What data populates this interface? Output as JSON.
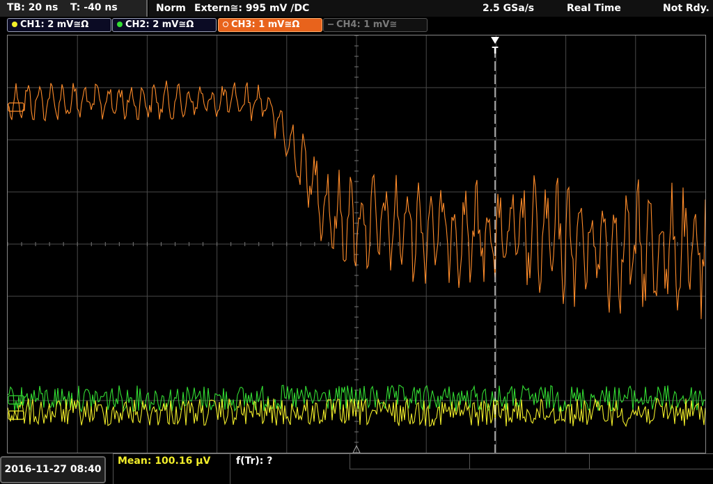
{
  "header": {
    "timebase": "TB: 20 ns",
    "trigger_time": "T: -40 ns",
    "mode": "Norm",
    "trigger": "Extern≅: 995 mV ∕DC",
    "sample_rate": "2.5 GSa/s",
    "acq_mode": "Real Time",
    "status": "Not Rdy."
  },
  "channels": [
    {
      "label": "CH1: 2 mV≅Ω",
      "color": "#f2ee2a",
      "active": false,
      "enabled": true
    },
    {
      "label": "CH2: 2 mV≅Ω",
      "color": "#33dd33",
      "active": false,
      "enabled": true
    },
    {
      "label": "CH3: 1 mV≅Ω",
      "color": "#ff8c2a",
      "active": true,
      "enabled": true
    },
    {
      "label": "CH4: 1 mV≅",
      "color": "#888888",
      "active": false,
      "enabled": false
    }
  ],
  "trigger_marker": {
    "label": "T"
  },
  "footer": {
    "datetime": "2016-11-27 08:40",
    "measurement_1": "Mean: 100.16 µV",
    "measurement_2": "f(Tr): ?"
  },
  "colors": {
    "ch1": "#f2ee2a",
    "ch2": "#33dd33",
    "ch3": "#ff8c2a",
    "grid": "#4a4a4a",
    "background": "#000000"
  }
}
